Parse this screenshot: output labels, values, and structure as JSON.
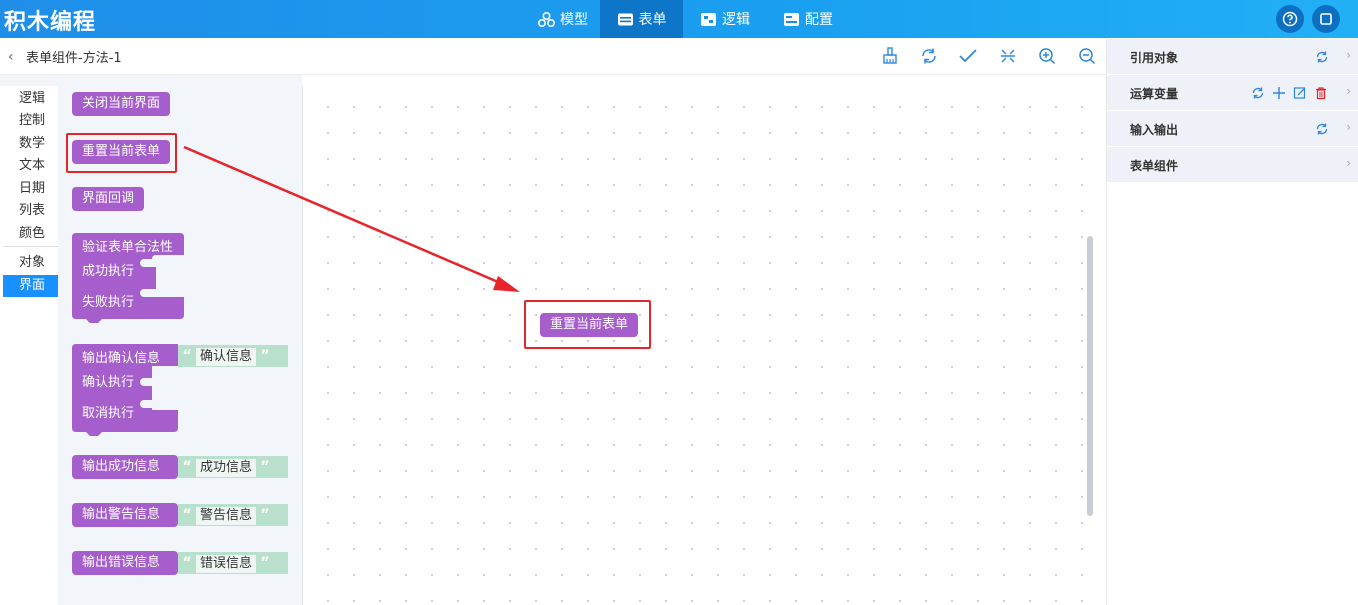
{
  "app": {
    "title": "积木编程"
  },
  "nav": {
    "tabs": [
      {
        "label": "模型",
        "icon": "cubes-icon"
      },
      {
        "label": "表单",
        "icon": "form-icon"
      },
      {
        "label": "逻辑",
        "icon": "puzzle-icon"
      },
      {
        "label": "配置",
        "icon": "config-icon"
      }
    ],
    "active": "表单"
  },
  "toolbar": {
    "breadcrumb": "表单组件-方法-1"
  },
  "categories": [
    "逻辑",
    "控制",
    "数学",
    "文本",
    "日期",
    "列表",
    "颜色",
    "对象",
    "界面"
  ],
  "active_category": "界面",
  "palette": {
    "close_view": "关闭当前界面",
    "reset_form": "重置当前表单",
    "view_callback": "界面回调",
    "validate": "验证表单合法性",
    "on_success": "成功执行",
    "on_fail": "失败执行",
    "confirm": "输出确认信息",
    "confirm_text": "确认信息",
    "on_confirm": "确认执行",
    "on_cancel": "取消执行",
    "success_msg": "输出成功信息",
    "success_text": "成功信息",
    "warning_msg": "输出警告信息",
    "warning_text": "警告信息",
    "error_msg": "输出错误信息",
    "error_text": "错误信息"
  },
  "workspace": {
    "block": "重置当前表单"
  },
  "right_panel": {
    "sections": [
      "引用对象",
      "运算变量",
      "输入输出",
      "表单组件"
    ]
  },
  "colors": {
    "accent": "#1890ff",
    "block": "#a55ecb",
    "text_slot": "#b9dfcd",
    "highlight": "#e8242b"
  }
}
